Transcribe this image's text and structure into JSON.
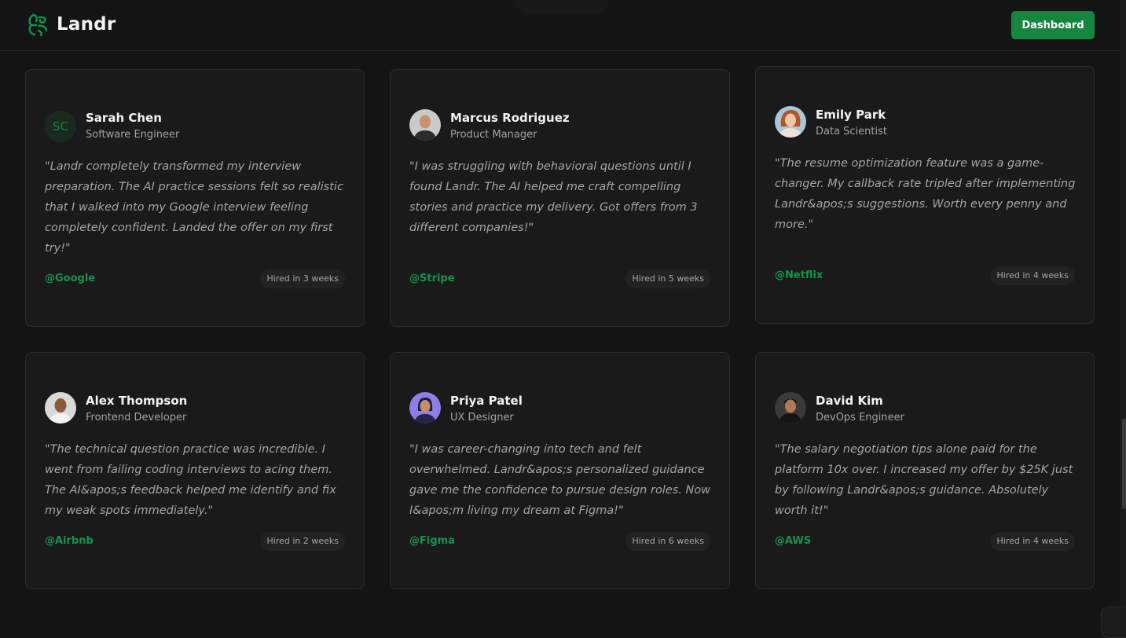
{
  "brand": {
    "name": "Landr"
  },
  "header": {
    "dashboard_label": "Dashboard"
  },
  "colors": {
    "accent": "#15853f",
    "background": "#141414",
    "card": "#1a1a1a"
  },
  "testimonials": [
    {
      "name": "Sarah Chen",
      "role": "Software Engineer",
      "initials": "SC",
      "quote": "\"Landr completely transformed my interview preparation. The AI practice sessions felt so realistic that I walked into my Google interview feeling completely confident. Landed the offer on my first try!\"",
      "company": "@Google",
      "hired": "Hired in 3 weeks"
    },
    {
      "name": "Marcus Rodriguez",
      "role": "Product Manager",
      "quote": "\"I was struggling with behavioral questions until I found Landr. The AI helped me craft compelling stories and practice my delivery. Got offers from 3 different companies!\"",
      "company": "@Stripe",
      "hired": "Hired in 5 weeks"
    },
    {
      "name": "Emily Park",
      "role": "Data Scientist",
      "quote": "\"The resume optimization feature was a game-changer. My callback rate tripled after implementing Landr&apos;s suggestions. Worth every penny and more.\"",
      "company": "@Netflix",
      "hired": "Hired in 4 weeks"
    },
    {
      "name": "Alex Thompson",
      "role": "Frontend Developer",
      "quote": "\"The technical question practice was incredible. I went from failing coding interviews to acing them. The AI&apos;s feedback helped me identify and fix my weak spots immediately.\"",
      "company": "@Airbnb",
      "hired": "Hired in 2 weeks"
    },
    {
      "name": "Priya Patel",
      "role": "UX Designer",
      "quote": "\"I was career-changing into tech and felt overwhelmed. Landr&apos;s personalized guidance gave me the confidence to pursue design roles. Now I&apos;m living my dream at Figma!\"",
      "company": "@Figma",
      "hired": "Hired in 6 weeks"
    },
    {
      "name": "David Kim",
      "role": "DevOps Engineer",
      "quote": "\"The salary negotiation tips alone paid for the platform 10x over. I increased my offer by $25K just by following Landr&apos;s guidance. Absolutely worth it!\"",
      "company": "@AWS",
      "hired": "Hired in 4 weeks"
    }
  ]
}
